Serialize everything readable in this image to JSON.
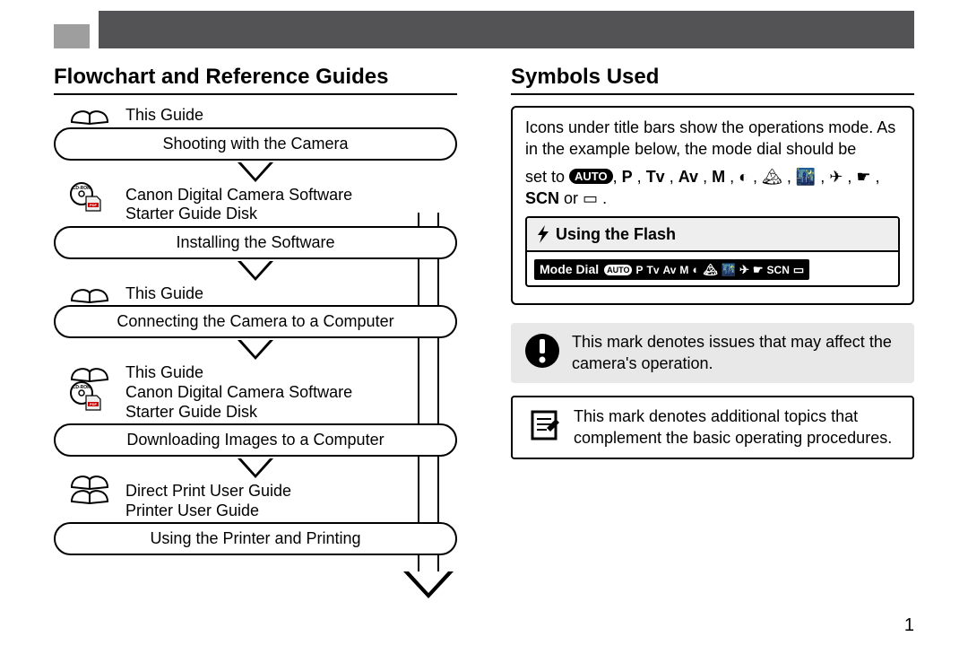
{
  "left": {
    "heading": "Flowchart and Reference Guides",
    "steps": [
      {
        "refs": [
          "This Guide"
        ],
        "action": "Shooting with the Camera"
      },
      {
        "refs": [
          "Canon Digital Camera Software",
          "Starter Guide Disk"
        ],
        "action": "Installing the Software",
        "iconset": "cd"
      },
      {
        "refs": [
          "This Guide"
        ],
        "action": "Connecting the Camera to a Computer"
      },
      {
        "refs": [
          "This Guide",
          "Canon Digital Camera Software",
          "Starter Guide Disk"
        ],
        "action": "Downloading Images to a Computer",
        "iconset": "book-cd"
      },
      {
        "refs": [
          "Direct Print User Guide",
          "Printer User Guide"
        ],
        "action": "Using the Printer and Printing",
        "iconset": "book-stack"
      }
    ]
  },
  "right": {
    "heading": "Symbols Used",
    "intro": {
      "line1": "Icons under title bars show the operations mode.",
      "line2": "As in the example below, the mode dial should be",
      "line3_prefix": "set to ",
      "modes_text": [
        "AUTO",
        "P",
        "Tv",
        "Av",
        "M"
      ],
      "line3_suffix": "or ",
      "line3_end": ".",
      "scn": "SCN"
    },
    "example": {
      "title": "Using the Flash",
      "mode_dial_label": "Mode Dial",
      "modes": [
        "AUTO",
        "P",
        "Tv",
        "Av",
        "M"
      ],
      "scn": "SCN"
    },
    "warning_note": "This mark denotes issues that may affect the camera's operation.",
    "memo_note": "This mark denotes additional topics that complement the basic operating procedures."
  },
  "page_number": "1"
}
